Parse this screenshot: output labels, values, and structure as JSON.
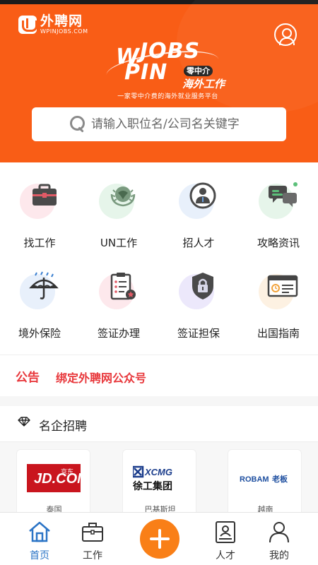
{
  "header": {
    "logo_cn": "外聘网",
    "logo_en": "WPINJOBS.COM",
    "brand_w": "W",
    "brand_jobs": "JOBS",
    "brand_pin": "PIN",
    "brand_badge": "零中介",
    "brand_sub": "海外工作",
    "brand_tagline": "一家零中介费的海外就业服务平台",
    "account_icon": "user-icon"
  },
  "search": {
    "placeholder": "请输入职位名/公司名关键字"
  },
  "features": [
    {
      "label": "找工作",
      "icon": "briefcase-icon",
      "bg": "#fde8ec"
    },
    {
      "label": "UN工作",
      "icon": "un-emblem-icon",
      "bg": "#e6f5ea"
    },
    {
      "label": "招人才",
      "icon": "person-badge-icon",
      "bg": "#e8f0fb"
    },
    {
      "label": "攻略资讯",
      "icon": "chat-bubbles-icon",
      "bg": "#e6f5ea"
    },
    {
      "label": "境外保险",
      "icon": "umbrella-icon",
      "bg": "#e8f0fb"
    },
    {
      "label": "签证办理",
      "icon": "clipboard-icon",
      "bg": "#fde8ec"
    },
    {
      "label": "签证担保",
      "icon": "shield-lock-icon",
      "bg": "#ece8fb"
    },
    {
      "label": "出国指南",
      "icon": "passport-card-icon",
      "bg": "#fdf1e2"
    }
  ],
  "notice": {
    "tag": "公告",
    "text": "绑定外聘网公众号"
  },
  "section": {
    "title": "名企招聘"
  },
  "companies": [
    {
      "name": "泰国",
      "logo_text": "JD.COM",
      "logo_cn": "京东"
    },
    {
      "name": "巴基斯坦",
      "logo_text": "XCMG",
      "logo_cn": "徐工集团"
    },
    {
      "name": "越南",
      "logo_text": "ROBAM",
      "logo_cn": "老板"
    }
  ],
  "tabs": [
    {
      "label": "首页",
      "icon": "home-icon",
      "active": true
    },
    {
      "label": "工作",
      "icon": "briefcase-icon",
      "active": false
    },
    {
      "label": "人才",
      "icon": "id-card-icon",
      "active": false
    },
    {
      "label": "我的",
      "icon": "user-icon",
      "active": false
    }
  ],
  "colors": {
    "brand_orange": "#f95d16",
    "notice_red": "#e8383c",
    "tab_active_blue": "#2b74c6",
    "fab_orange": "#f97f17"
  }
}
